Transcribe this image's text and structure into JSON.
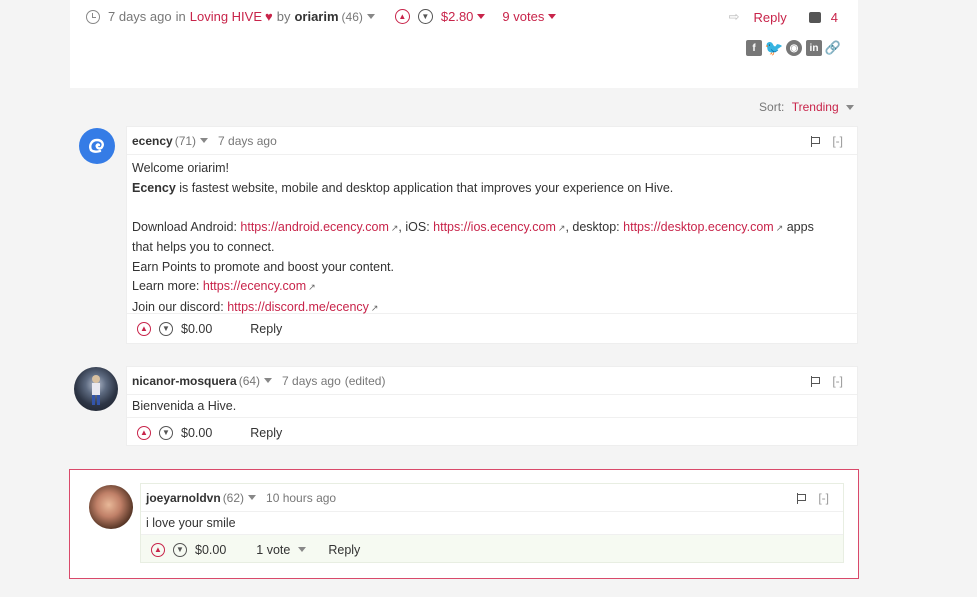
{
  "post": {
    "time": "7 days ago",
    "in_label": "in",
    "community": "Loving HIVE",
    "heart": "♥",
    "by_label": "by",
    "author": "oriarim",
    "reputation": "(46)",
    "payout": "$2.80",
    "votes": "9 votes",
    "reply_label": "Reply",
    "comment_count": "4",
    "share_icons": [
      "facebook-icon",
      "twitter-icon",
      "reddit-icon",
      "linkedin-icon",
      "link-icon"
    ]
  },
  "sort": {
    "label": "Sort:",
    "value": "Trending"
  },
  "comments": [
    {
      "author": "ecency",
      "reputation": "(71)",
      "time": "7 days ago",
      "edited": "",
      "lines": [
        "Welcome oriarim!",
        "Ecency",
        " is fastest website, mobile and desktop application that improves your experience on Hive.",
        "Download Android: ",
        "https://android.ecency.com",
        ", iOS: ",
        "https://ios.ecency.com",
        ", desktop: ",
        "https://desktop.ecency.com",
        " apps",
        "that helps you to connect.",
        "Earn Points to promote and boost your content.",
        "Learn more: ",
        "https://ecency.com",
        "Join our discord: ",
        "https://discord.me/ecency"
      ],
      "payout": "$0.00",
      "reply_label": "Reply",
      "collapse": "[-]"
    },
    {
      "author": "nicanor-mosquera",
      "reputation": "(64)",
      "time": "7 days ago",
      "edited": "(edited)",
      "body": "Bienvenida a Hive.",
      "payout": "$0.00",
      "reply_label": "Reply",
      "collapse": "[-]"
    },
    {
      "author": "joeyarnoldvn",
      "reputation": "(62)",
      "time": "10 hours ago",
      "edited": "",
      "body": "i love your smile",
      "payout": "$0.00",
      "votes": "1 vote",
      "reply_label": "Reply",
      "collapse": "[-]"
    }
  ],
  "colors": {
    "accent": "#c8244a",
    "ecency_blue": "#357ce6",
    "highlight_bg": "#f6faf2"
  }
}
